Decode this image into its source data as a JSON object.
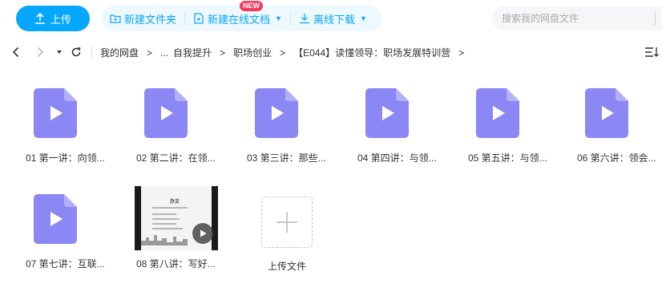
{
  "toolbar": {
    "upload_label": "上传",
    "new_folder_label": "新建文件夹",
    "new_doc_label": "新建在线文档",
    "new_badge": "NEW",
    "offline_download_label": "离线下载",
    "search_placeholder": "搜索我的网盘文件"
  },
  "breadcrumb": {
    "items": [
      "我的网盘",
      "...",
      "自我提升",
      "职场创业",
      "【E044】读懂领导：职场发展特训营"
    ],
    "separator": ">"
  },
  "files": [
    {
      "name": "01 第一讲：向领...",
      "type": "video"
    },
    {
      "name": "02 第二讲：在领...",
      "type": "video"
    },
    {
      "name": "03 第三讲：那些...",
      "type": "video"
    },
    {
      "name": "04 第四讲：与领...",
      "type": "video"
    },
    {
      "name": "05 第五讲：与领...",
      "type": "video"
    },
    {
      "name": "06 第六讲：领会...",
      "type": "video"
    },
    {
      "name": "07 第七讲：互联...",
      "type": "video"
    },
    {
      "name": "08 第八讲：写好...",
      "type": "video-thumbnail"
    }
  ],
  "thumbnail": {
    "title": "办文"
  },
  "upload_file_label": "上传文件",
  "colors": {
    "accent": "#06a7ff",
    "video_icon": "#8b87f5",
    "badge": "#f23c5f"
  }
}
